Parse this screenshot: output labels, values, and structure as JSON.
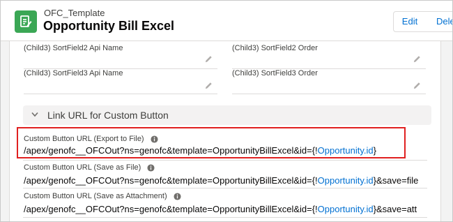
{
  "header": {
    "object_label": "OFC_Template",
    "record_title": "Opportunity Bill Excel",
    "edit_label": "Edit",
    "delete_label": "Delete"
  },
  "fields": {
    "sort2_api": "(Child3) SortField2 Api Name",
    "sort2_order": "(Child3) SortField2 Order",
    "sort3_api": "(Child3) SortField3 Api Name",
    "sort3_order": "(Child3) SortField3 Order"
  },
  "section": {
    "title": "Link URL for Custom Button"
  },
  "urls": [
    {
      "label": "Custom Button URL (Export to File)",
      "prefix": "/apex/genofc__OFCOut?ns=genofc&template=OpportunityBillExcel&id={!",
      "link": "Opportunity.id",
      "suffix": "}"
    },
    {
      "label": "Custom Button URL (Save as File)",
      "prefix": "/apex/genofc__OFCOut?ns=genofc&template=OpportunityBillExcel&id={!",
      "link": "Opportunity.id",
      "suffix": "}&save=file"
    },
    {
      "label": "Custom Button URL (Save as Attachment)",
      "prefix": "/apex/genofc__OFCOut?ns=genofc&template=OpportunityBillExcel&id={!",
      "link": "Opportunity.id",
      "suffix": "}&save=att"
    }
  ],
  "colors": {
    "app_icon": "#3ba755",
    "link": "#0070d2",
    "highlight": "#e02020"
  },
  "icons": {
    "app": "template-icon",
    "edit_field": "pencil-icon",
    "section_toggle": "chevron-down-icon",
    "help": "info-icon"
  }
}
